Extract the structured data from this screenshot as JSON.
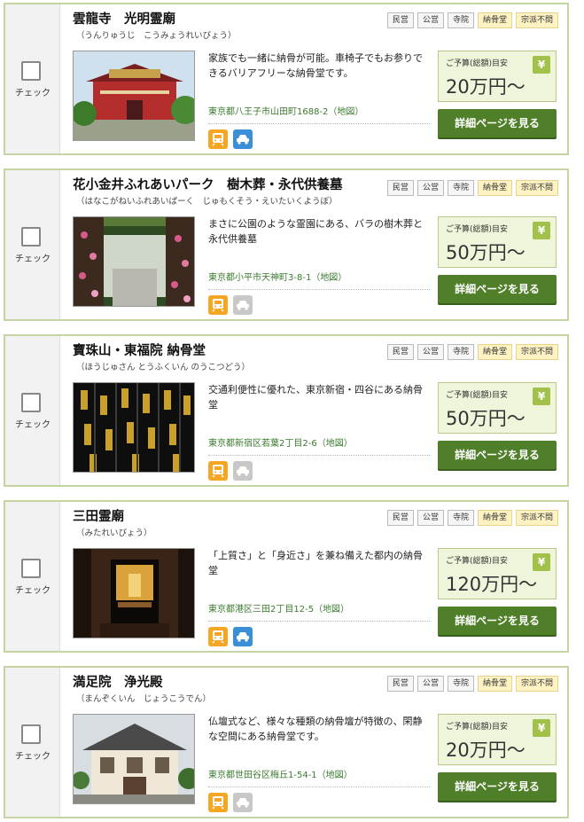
{
  "common": {
    "check_label": "チェック",
    "price_label": "ご予算(総額)目安",
    "yen_symbol": "¥",
    "detail_button": "詳細ページを見る",
    "map_link": "地図",
    "tags": [
      "民営",
      "公営",
      "寺院",
      "納骨堂",
      "宗派不問"
    ]
  },
  "cards": [
    {
      "name": "雲龍寺　光明霊廟",
      "reading": "（うんりゅうじ　こうみょうれいびょう）",
      "description": "家族でも一緒に納骨が可能。車椅子でもお参りできるバリアフリーな納骨堂です。",
      "address": "東京都八王子市山田町1688-2",
      "price": "20万円〜",
      "car_available": true
    },
    {
      "name": "花小金井ふれあいパーク　樹木葬・永代供養墓",
      "reading": "（はなこがねいふれあいぱーく　じゅもくそう・えいたいくようぼ）",
      "description": "まさに公園のような霊園にある、バラの樹木葬と永代供養墓",
      "address": "東京都小平市天神町3-8-1",
      "price": "50万円〜",
      "car_available": false
    },
    {
      "name": "寶珠山・東福院 納骨堂",
      "reading": "（ほうじゅさん とうふくいん のうこつどう）",
      "description": "交通利便性に優れた、東京新宿・四谷にある納骨堂",
      "address": "東京都新宿区若葉2丁目2-6",
      "price": "50万円〜",
      "car_available": false
    },
    {
      "name": "三田霊廟",
      "reading": "（みたれいびょう）",
      "description": "「上質さ」と「身近さ」を兼ね備えた都内の納骨堂",
      "address": "東京都港区三田2丁目12-5",
      "price": "120万円〜",
      "car_available": true
    },
    {
      "name": "満足院　浄光殿",
      "reading": "（まんぞくいん　じょうこうでん）",
      "description": "仏壇式など、様々な種類の納骨壇が特徴の、閑静な空間にある納骨堂です。",
      "address": "東京都世田谷区梅丘1-54-1",
      "price": "20万円〜",
      "car_available": false
    }
  ]
}
